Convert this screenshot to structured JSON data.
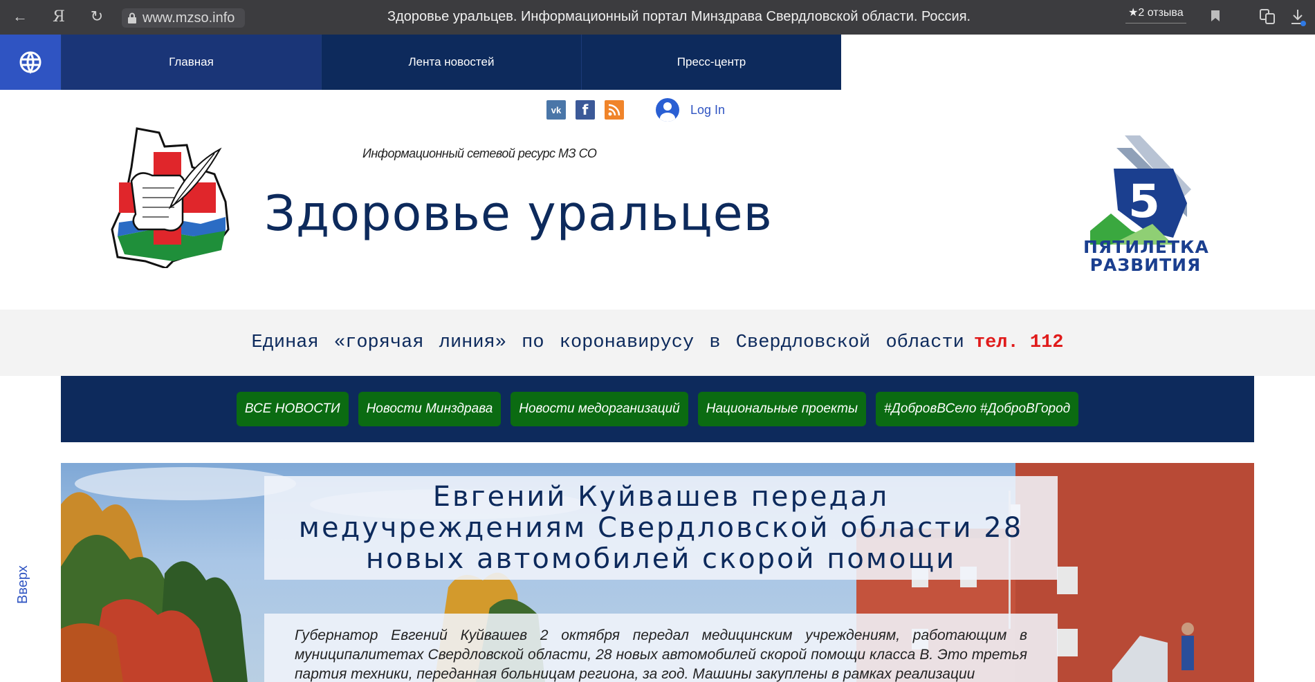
{
  "browser": {
    "url": "www.mzso.info",
    "title": "Здоровье уральцев. Информационный портал Минздрава Свердловской области. Россия.",
    "reviews_label": "★2 отзыва",
    "back_glyph": "←",
    "yandex_glyph": "Я",
    "reload_glyph": "↻"
  },
  "topnav": {
    "items": [
      {
        "label": "Главная"
      },
      {
        "label": "Лента новостей"
      },
      {
        "label": "Пресс-центр"
      }
    ]
  },
  "social": {
    "vk": "vk",
    "fb": "f",
    "login_label": "Log In"
  },
  "header": {
    "tagline": "Информационный сетевой ресурс МЗ СО",
    "site_title": "Здоровье уральцев",
    "right_logo": {
      "number": "5",
      "line1": "ПЯТИЛЕТКА",
      "line2": "РАЗВИТИЯ"
    }
  },
  "hotline": {
    "text": "Единая «горячая линия» по коронавирусу в Свердловской области",
    "phone": "тел. 112"
  },
  "categories": [
    {
      "label": "ВСЕ НОВОСТИ"
    },
    {
      "label": "Новости Минздрава"
    },
    {
      "label": "Новости медорганизаций"
    },
    {
      "label": "Национальные проекты"
    },
    {
      "label": "#ДобровВСело #ДоброВГород"
    }
  ],
  "hero": {
    "headline": "Евгений Куйвашев передал медучреждениям Свердловской области 28 новых автомобилей скорой помощи",
    "summary": "Губернатор Евгений Куйвашев 2 октября передал медицинским учреждениям, работающим в муниципалитетах Свердловской области, 28 новых автомобилей скорой помощи класса В. Это третья партия техники, переданная больницам региона, за год. Машины закуплены в рамках реализации"
  },
  "side": {
    "up_label": "Вверх"
  },
  "colors": {
    "navy": "#0d2a5c",
    "nav_active": "#1a3577",
    "globe_blue": "#2f54c2",
    "category_green": "#0b6b12",
    "phone_red": "#e01b1b",
    "hotline_bg": "#f3f3f3"
  }
}
